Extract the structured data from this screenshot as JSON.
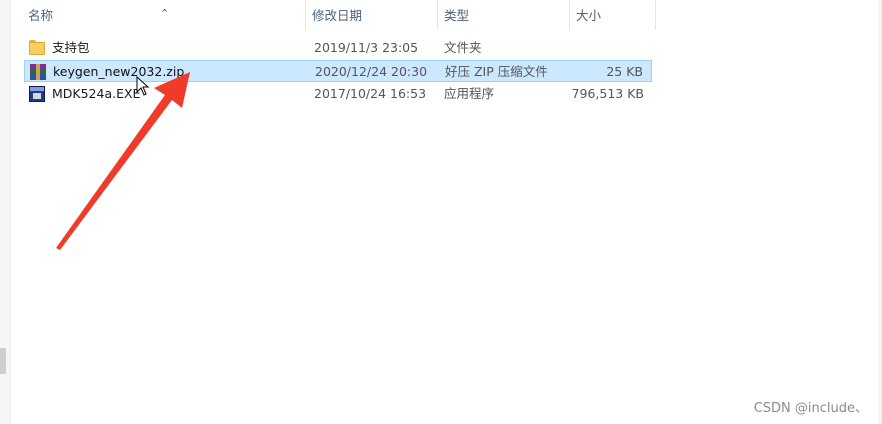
{
  "columns": {
    "name": "名称",
    "date": "修改日期",
    "type": "类型",
    "size": "大小"
  },
  "files": [
    {
      "icon": "folder-icon",
      "name": "支持包",
      "date": "2019/11/3 23:05",
      "type": "文件夹",
      "size": ""
    },
    {
      "icon": "zip-archive-icon",
      "name": "keygen_new2032.zip",
      "date": "2020/12/24 20:30",
      "type": "好压 ZIP 压缩文件",
      "size": "25 KB",
      "selected": true
    },
    {
      "icon": "exe-app-icon",
      "name": "MDK524a.EXE",
      "date": "2017/10/24 16:53",
      "type": "应用程序",
      "size": "796,513 KB"
    }
  ],
  "annotation": {
    "color": "#f03a2a"
  },
  "watermark": "CSDN @include、"
}
